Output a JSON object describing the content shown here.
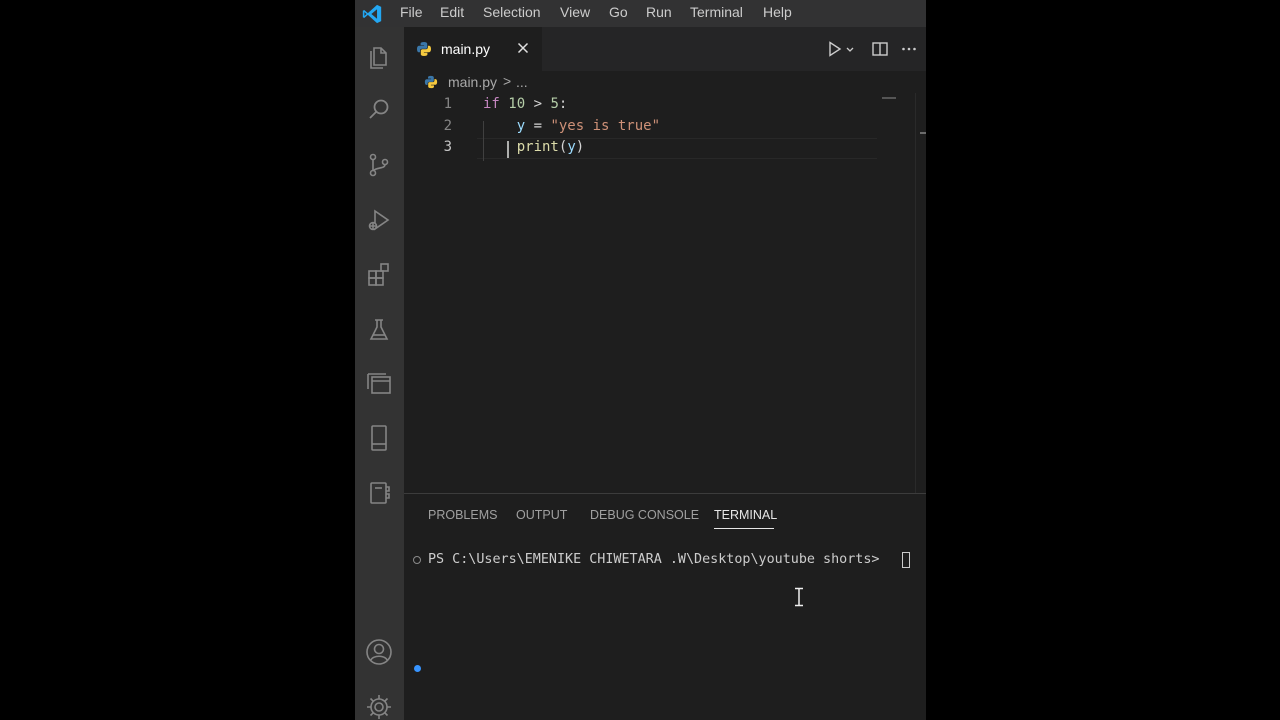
{
  "menubar": {
    "logo": "vscode-logo-icon",
    "items": [
      "File",
      "Edit",
      "Selection",
      "View",
      "Go",
      "Run",
      "Terminal",
      "Help"
    ]
  },
  "activity_bar": {
    "top_icons": [
      "explorer-icon",
      "search-icon",
      "source-control-icon",
      "run-debug-icon",
      "extensions-icon",
      "testing-icon",
      "remote-explorer-icon",
      "phone-icon",
      "notebook-icon"
    ],
    "bottom_icons": [
      "accounts-icon",
      "manage-gear-icon"
    ]
  },
  "editor": {
    "tab": {
      "label": "main.py",
      "icon": "python-icon"
    },
    "breadcrumb": {
      "file": "main.py",
      "separator": ">",
      "more": "..."
    },
    "lines": [
      {
        "number": "1",
        "tokens": [
          {
            "text": "if",
            "kind": "kw"
          },
          {
            "text": " ",
            "kind": "op"
          },
          {
            "text": "10",
            "kind": "num"
          },
          {
            "text": " > ",
            "kind": "op"
          },
          {
            "text": "5",
            "kind": "num"
          },
          {
            "text": ":",
            "kind": "op"
          }
        ]
      },
      {
        "number": "2",
        "tokens": [
          {
            "text": "    ",
            "kind": "op"
          },
          {
            "text": "y",
            "kind": "var"
          },
          {
            "text": " = ",
            "kind": "op"
          },
          {
            "text": "\"yes is true\"",
            "kind": "str"
          }
        ]
      },
      {
        "number": "3",
        "tokens": [
          {
            "text": "    ",
            "kind": "op"
          },
          {
            "text": "print",
            "kind": "fn"
          },
          {
            "text": "(",
            "kind": "op"
          },
          {
            "text": "y",
            "kind": "var"
          },
          {
            "text": ")",
            "kind": "op"
          }
        ]
      }
    ],
    "active_line": "3"
  },
  "panel": {
    "tabs": [
      "PROBLEMS",
      "OUTPUT",
      "DEBUG CONSOLE",
      "TERMINAL"
    ],
    "active_tab": "TERMINAL",
    "terminal_prompt": "PS C:\\Users\\EMENIKE CHIWETARA .W\\Desktop\\youtube shorts> "
  },
  "colors": {
    "keyword": "#c586c0",
    "number": "#b5cea8",
    "variable": "#9cdcfe",
    "string": "#ce9178",
    "function": "#dcdcaa",
    "accent": "#3794ff"
  }
}
